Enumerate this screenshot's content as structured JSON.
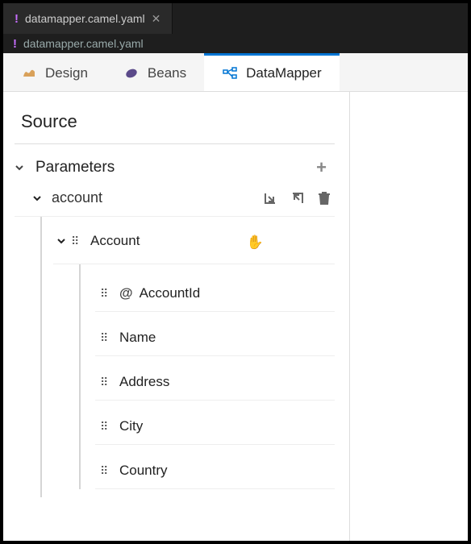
{
  "editor": {
    "active_tab": "datamapper.camel.yaml",
    "breadcrumb": "datamapper.camel.yaml"
  },
  "panel_tabs": {
    "design": "Design",
    "beans": "Beans",
    "datamapper": "DataMapper"
  },
  "source": {
    "title": "Source",
    "parameters_label": "Parameters",
    "account": {
      "name": "account",
      "type": "Account",
      "fields": [
        {
          "name": "AccountId",
          "attr": true
        },
        {
          "name": "Name",
          "attr": false
        },
        {
          "name": "Address",
          "attr": false
        },
        {
          "name": "City",
          "attr": false
        },
        {
          "name": "Country",
          "attr": false
        }
      ]
    }
  }
}
